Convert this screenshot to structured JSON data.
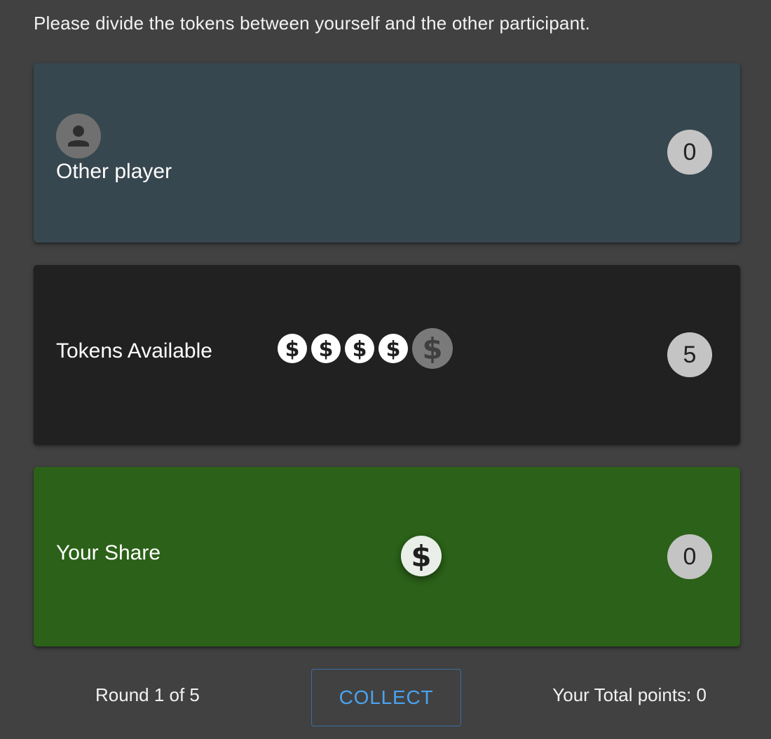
{
  "instructions": "Please divide the tokens between yourself and the other participant.",
  "other_player": {
    "label": "Other player",
    "count": "0",
    "icon": "person-icon"
  },
  "tokens_available": {
    "label": "Tokens Available",
    "count": "5",
    "token_icon": "dollar-icon"
  },
  "your_share": {
    "label": "Your Share",
    "count": "0",
    "token_icon": "dollar-icon"
  },
  "footer": {
    "round": "Round 1 of 5",
    "collect_label": "COLLECT",
    "total_points": "Your Total points: 0"
  },
  "colors": {
    "background": "#414141",
    "other_player_card": "#37474f",
    "tokens_card": "#212121",
    "share_card": "#2b6118",
    "badge": "#c4c4c4",
    "accent": "#4aa3f0"
  }
}
